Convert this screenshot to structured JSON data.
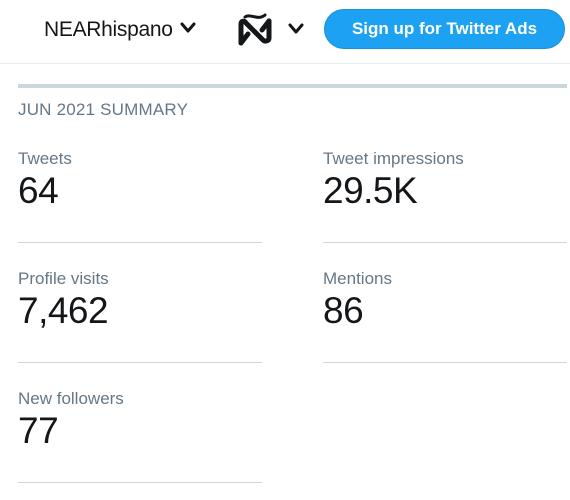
{
  "header": {
    "account_name": "NEARhispano",
    "signup_label": "Sign up for Twitter Ads",
    "icons": [
      "chevron-down-icon",
      "near-hispano-logo"
    ],
    "accent_color": "#1da1f2"
  },
  "summary": {
    "title": "JUN 2021 SUMMARY",
    "metrics": [
      {
        "label": "Tweets",
        "value": "64"
      },
      {
        "label": "Tweet impressions",
        "value": "29.5K"
      },
      {
        "label": "Profile visits",
        "value": "7,462"
      },
      {
        "label": "Mentions",
        "value": "86"
      },
      {
        "label": "New followers",
        "value": "77"
      }
    ]
  }
}
